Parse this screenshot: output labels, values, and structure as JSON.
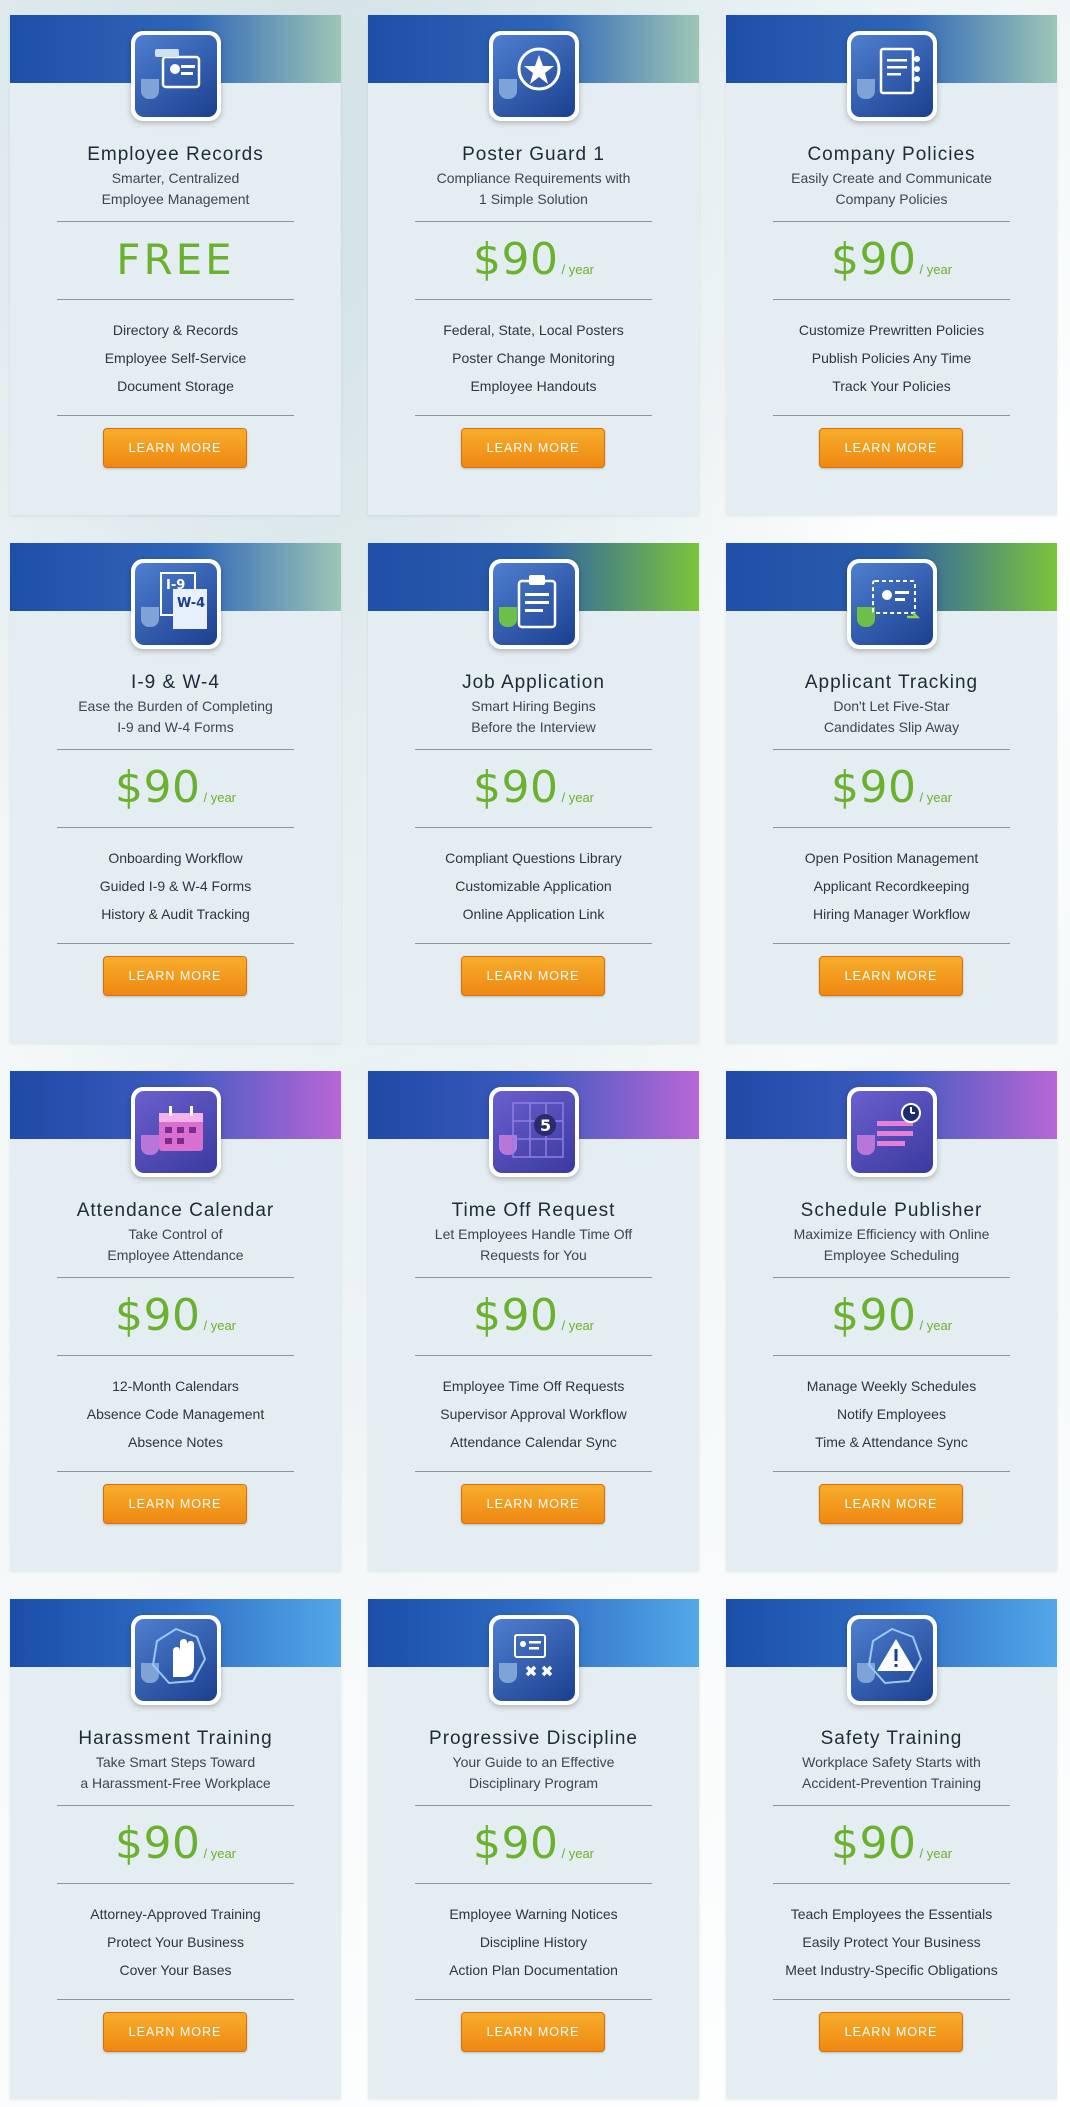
{
  "colors": {
    "price_green": "#6ab12e",
    "button_orange": "#ef8813",
    "card_bg": "#e4edf1",
    "band_dark_blue": "#1e4fa8"
  },
  "cta_label": "LEARN MORE",
  "per_year": "/ year",
  "products": [
    {
      "icon": "id-badge-icon",
      "band": "records",
      "title": "Employee Records",
      "subtitle": "Smarter, Centralized\nEmployee Management",
      "price": "FREE",
      "period": "",
      "features": [
        "Directory & Records",
        "Employee Self-Service",
        "Document Storage"
      ],
      "cta": "LEARN MORE"
    },
    {
      "icon": "star-badge-icon",
      "band": "records",
      "title": "Poster Guard 1",
      "subtitle": "Compliance Requirements with\n1 Simple Solution",
      "price": "$90",
      "period": "/ year",
      "features": [
        "Federal, State, Local Posters",
        "Poster Change Monitoring",
        "Employee Handouts"
      ],
      "cta": "LEARN MORE"
    },
    {
      "icon": "policy-document-icon",
      "band": "records",
      "title": "Company Policies",
      "subtitle": "Easily Create and Communicate\nCompany Policies",
      "price": "$90",
      "period": "/ year",
      "features": [
        "Customize Prewritten Policies",
        "Publish Policies Any Time",
        "Track Your Policies"
      ],
      "cta": "LEARN MORE"
    },
    {
      "icon": "i9-w4-forms-icon",
      "band": "records",
      "title": "I-9 & W-4",
      "subtitle": "Ease the Burden of Completing\nI-9 and W-4 Forms",
      "price": "$90",
      "period": "/ year",
      "features": [
        "Onboarding Workflow",
        "Guided I-9 & W-4 Forms",
        "History & Audit Tracking"
      ],
      "cta": "LEARN MORE"
    },
    {
      "icon": "clipboard-icon",
      "band": "hiring",
      "title": "Job Application",
      "subtitle": "Smart Hiring Begins\nBefore the Interview",
      "price": "$90",
      "period": "/ year",
      "features": [
        "Compliant Questions Library",
        "Customizable Application",
        "Online Application Link"
      ],
      "cta": "LEARN MORE"
    },
    {
      "icon": "applicant-card-icon",
      "band": "hiring",
      "title": "Applicant Tracking",
      "subtitle": "Don't Let Five-Star\nCandidates Slip Away",
      "price": "$90",
      "period": "/ year",
      "features": [
        "Open Position Management",
        "Applicant Recordkeeping",
        "Hiring Manager Workflow"
      ],
      "cta": "LEARN MORE"
    },
    {
      "icon": "calendar-icon",
      "band": "purple",
      "title": "Attendance Calendar",
      "subtitle": "Take Control of\nEmployee Attendance",
      "price": "$90",
      "period": "/ year",
      "features": [
        "12-Month Calendars",
        "Absence Code Management",
        "Absence Notes"
      ],
      "cta": "LEARN MORE"
    },
    {
      "icon": "calendar-date-icon",
      "band": "purple",
      "title": "Time Off Request",
      "subtitle": "Let Employees Handle Time Off\nRequests for You",
      "price": "$90",
      "period": "/ year",
      "features": [
        "Employee Time Off Requests",
        "Supervisor Approval Workflow",
        "Attendance Calendar Sync"
      ],
      "cta": "LEARN MORE"
    },
    {
      "icon": "schedule-clock-icon",
      "band": "purple",
      "title": "Schedule Publisher",
      "subtitle": "Maximize Efficiency with Online\nEmployee Scheduling",
      "price": "$90",
      "period": "/ year",
      "features": [
        "Manage Weekly Schedules",
        "Notify Employees",
        "Time & Attendance Sync"
      ],
      "cta": "LEARN MORE"
    },
    {
      "icon": "stop-hand-icon",
      "band": "blue",
      "title": "Harassment Training",
      "subtitle": "Take Smart Steps Toward\na Harassment-Free Workplace",
      "price": "$90",
      "period": "/ year",
      "features": [
        "Attorney-Approved Training",
        "Protect Your Business",
        "Cover Your Bases"
      ],
      "cta": "LEARN MORE"
    },
    {
      "icon": "discipline-form-icon",
      "band": "blue",
      "title": "Progressive Discipline",
      "subtitle": "Your Guide to an Effective\nDisciplinary Program",
      "price": "$90",
      "period": "/ year",
      "features": [
        "Employee Warning Notices",
        "Discipline History",
        "Action Plan Documentation"
      ],
      "cta": "LEARN MORE"
    },
    {
      "icon": "warning-sign-icon",
      "band": "blue",
      "title": "Safety Training",
      "subtitle": "Workplace Safety Starts with\nAccident-Prevention Training",
      "price": "$90",
      "period": "/ year",
      "features": [
        "Teach Employees the Essentials",
        "Easily Protect Your Business",
        "Meet Industry-Specific Obligations"
      ],
      "cta": "LEARN MORE"
    }
  ]
}
